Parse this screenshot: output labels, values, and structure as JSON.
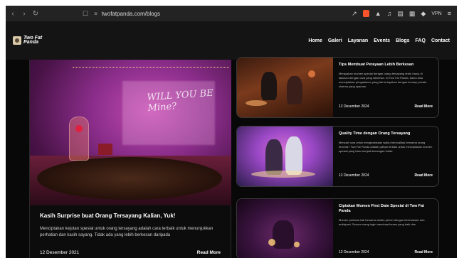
{
  "browser": {
    "url": "twofatpanda.com/blogs",
    "vpn_label": "VPN"
  },
  "site": {
    "logo": {
      "line1": "Two Fat",
      "line2": "Panda"
    },
    "nav": [
      "Home",
      "Galeri",
      "Layanan",
      "Events",
      "Blogs",
      "FAQ",
      "Contact"
    ]
  },
  "feature": {
    "title": "Kasih Surprise buat Orang Tersayang Kalian, Yuk!",
    "excerpt": "Menciptakan kejutan spesial untuk orang tersayang adalah cara terbaik untuk menunjukkan perhatian dan kasih sayang. Tidak ada yang lebih berkesan daripada",
    "date": "12 Desember 2021",
    "read_more": "Read More",
    "image_text": "WILL YOU BE Mine?"
  },
  "cards": [
    {
      "title": "Tips Membuat Perayaan Lebih Berkesan",
      "excerpt": "Merayakan momen spesial dengan orang tersayang tentu harus di lakukan dengan cara yang istimewa. Di Two Fat Panda, kamu bisa menciptakan pengalaman yang tak terlupakan dengan konsep private cinema yang nyaman.",
      "date": "12 Desember 2024",
      "read_more": "Read More"
    },
    {
      "title": "Quality Time dengan Orang Tersayang",
      "excerpt": "Mencari cara untuk menghabiskan waktu berkualitas bersama orang tercinta? Two Fat Panda adalah pilihan terbaik untuk menciptakan momen spesial yang bisa menjadi kenangan indah.",
      "date": "12 Desember 2024",
      "read_more": "Read More"
    },
    {
      "title": "Ciptakan Momen First Date Spesial di Two Fat Panda",
      "excerpt": "Momen pertama kali bersama selalu penuh dengan kecemasan dan antisipasi. Semua orang ingin membuat kesan yang baik dan",
      "date": "12 Desember 2024",
      "read_more": "Read More"
    }
  ]
}
